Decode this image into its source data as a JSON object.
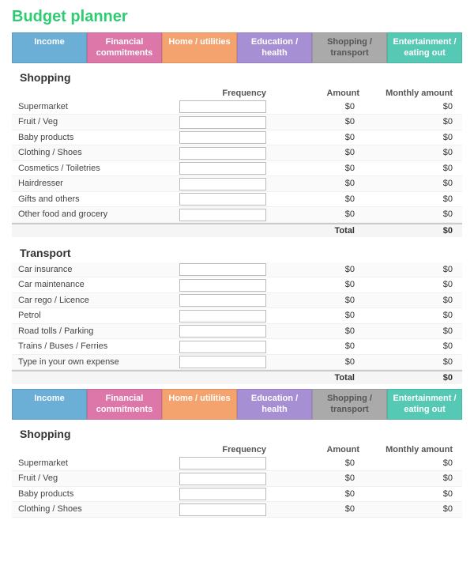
{
  "title": "Budget planner",
  "tabs": [
    {
      "id": "income",
      "label": "Income",
      "class": "tab-income"
    },
    {
      "id": "financial",
      "label": "Financial commitments",
      "class": "tab-financial"
    },
    {
      "id": "home",
      "label": "Home / utilities",
      "class": "tab-home"
    },
    {
      "id": "education",
      "label": "Education / health",
      "class": "tab-education"
    },
    {
      "id": "shopping",
      "label": "Shopping / transport",
      "class": "tab-shopping"
    },
    {
      "id": "entertainment",
      "label": "Entertainment / eating out",
      "class": "tab-entertainment"
    }
  ],
  "shopping_section": {
    "title": "Shopping",
    "columns": [
      "",
      "Frequency",
      "Amount",
      "Monthly amount"
    ],
    "rows": [
      "Supermarket",
      "Fruit / Veg",
      "Baby products",
      "Clothing / Shoes",
      "Cosmetics / Toiletries",
      "Hairdresser",
      "Gifts and others",
      "Other food and grocery"
    ],
    "amounts": [
      "$0",
      "$0",
      "$0",
      "$0",
      "$0",
      "$0",
      "$0",
      "$0"
    ],
    "monthly": [
      "$0",
      "$0",
      "$0",
      "$0",
      "$0",
      "$0",
      "$0",
      "$0"
    ],
    "total_label": "Total",
    "total_value": "$0"
  },
  "transport_section": {
    "title": "Transport",
    "columns": [
      "",
      "Frequency",
      "Amount",
      "Monthly amount"
    ],
    "rows": [
      "Car insurance",
      "Car maintenance",
      "Car rego / Licence",
      "Petrol",
      "Road tolls / Parking",
      "Trains / Buses / Ferries",
      "Type in your own expense"
    ],
    "amounts": [
      "$0",
      "$0",
      "$0",
      "$0",
      "$0",
      "$0",
      "$0"
    ],
    "monthly": [
      "$0",
      "$0",
      "$0",
      "$0",
      "$0",
      "$0",
      "$0"
    ],
    "total_label": "Total",
    "total_value": "$0"
  },
  "shopping_section2": {
    "title": "Shopping",
    "columns": [
      "",
      "Frequency",
      "Amount",
      "Monthly amount"
    ],
    "rows": [
      "Supermarket",
      "Fruit / Veg",
      "Baby products",
      "Clothing / Shoes"
    ],
    "amounts": [
      "$0",
      "$0",
      "$0",
      "$0"
    ],
    "monthly": [
      "$0",
      "$0",
      "$0",
      "$0"
    ]
  }
}
